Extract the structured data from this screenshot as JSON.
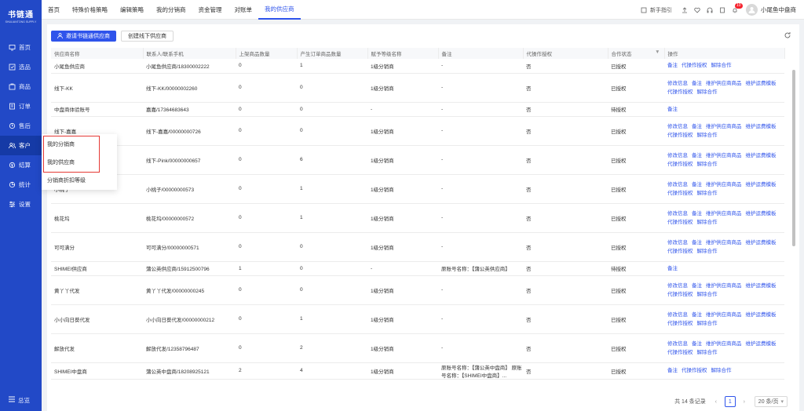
{
  "brand": {
    "name": "书链通",
    "sub": "SHULIANTONG SUPPLY"
  },
  "sidebar": {
    "items": [
      {
        "label": "首页",
        "icon": "monitor-icon"
      },
      {
        "label": "选品",
        "icon": "select-icon"
      },
      {
        "label": "商品",
        "icon": "goods-icon"
      },
      {
        "label": "订单",
        "icon": "order-icon"
      },
      {
        "label": "售后",
        "icon": "aftersale-icon"
      },
      {
        "label": "客户",
        "icon": "customer-icon"
      },
      {
        "label": "结算",
        "icon": "settle-icon"
      },
      {
        "label": "统计",
        "icon": "stats-icon"
      },
      {
        "label": "设置",
        "icon": "settings-icon"
      }
    ],
    "bottom": "总览"
  },
  "topnav": {
    "tabs": [
      "首页",
      "特殊价格策略",
      "编辑策略",
      "我的分销商",
      "资金管理",
      "对账单",
      "我的供应商"
    ],
    "active": 6
  },
  "topright": {
    "guide": "新手指引",
    "badge": "10",
    "user": "小尾鱼中盘商"
  },
  "toolbar": {
    "invite": "邀请书链通供应商",
    "create": "创建线下供应商"
  },
  "table": {
    "headers": [
      "供应商名称",
      "联系人/联系手机",
      "上架商品数量",
      "产生订单商品数量",
      "赋予等级名称",
      "备注",
      "代操作授权",
      "合作状态",
      "操作"
    ],
    "rows": [
      {
        "cells": [
          "小尾鱼供应商",
          "小尾鱼供应商/18300002222",
          "0",
          "1",
          "1级分销商",
          "-",
          "否",
          "已授权"
        ],
        "ops": [
          "备注",
          "代操作授权",
          "解除合作"
        ]
      },
      {
        "cells": [
          "线下-KK",
          "线下-KK/00000002260",
          "0",
          "0",
          "1级分销商",
          "-",
          "否",
          "已授权"
        ],
        "ops": [
          "修改信息",
          "备注",
          "维护供应商商品",
          "维护运费模板",
          "代操作授权",
          "解除合作"
        ]
      },
      {
        "cells": [
          "中盘商体验账号",
          "嘉嘉/17364683643",
          "0",
          "0",
          "-",
          "-",
          "否",
          "待授权"
        ],
        "ops": [
          "备注"
        ]
      },
      {
        "cells": [
          "线下-嘉嘉",
          "线下-嘉嘉/00000000726",
          "0",
          "0",
          "1级分销商",
          "-",
          "否",
          "已授权"
        ],
        "ops": [
          "修改信息",
          "备注",
          "维护供应商商品",
          "维护运费模板",
          "代操作授权",
          "解除合作"
        ]
      },
      {
        "cells": [
          "线下-Pink",
          "线下-Pink/00000000657",
          "0",
          "6",
          "1级分销商",
          "-",
          "否",
          "已授权"
        ],
        "ops": [
          "修改信息",
          "备注",
          "维护供应商商品",
          "维护运费模板",
          "代操作授权",
          "解除合作"
        ]
      },
      {
        "cells": [
          "小桃子",
          "小桃子/00000000573",
          "0",
          "1",
          "1级分销商",
          "-",
          "否",
          "已授权"
        ],
        "ops": [
          "修改信息",
          "备注",
          "维护供应商商品",
          "维护运费模板",
          "代操作授权",
          "解除合作"
        ]
      },
      {
        "cells": [
          "桃花坞",
          "桃花坞/00000000572",
          "0",
          "1",
          "1级分销商",
          "-",
          "否",
          "已授权"
        ],
        "ops": [
          "修改信息",
          "备注",
          "维护供应商商品",
          "维护运费模板",
          "代操作授权",
          "解除合作"
        ]
      },
      {
        "cells": [
          "可可满分",
          "可可满分/00000000571",
          "0",
          "0",
          "1级分销商",
          "-",
          "否",
          "已授权"
        ],
        "ops": [
          "修改信息",
          "备注",
          "维护供应商商品",
          "维护运费模板",
          "代操作授权",
          "解除合作"
        ]
      },
      {
        "cells": [
          "SHIMEI供应商",
          "蒲公英供应商/15912500796",
          "1",
          "0",
          "-",
          "原账号名称：【蒲公英供应商】",
          "否",
          "待授权"
        ],
        "ops": [
          "备注"
        ]
      },
      {
        "cells": [
          "黄丫丫代发",
          "黄丫丫代发/00000000245",
          "0",
          "0",
          "1级分销商",
          "-",
          "否",
          "已授权"
        ],
        "ops": [
          "修改信息",
          "备注",
          "维护供应商商品",
          "维护运费模板",
          "代操作授权",
          "解除合作"
        ]
      },
      {
        "cells": [
          "小小向日葵代发",
          "小小向日葵代发/00000000212",
          "0",
          "1",
          "1级分销商",
          "-",
          "否",
          "已授权"
        ],
        "ops": [
          "修改信息",
          "备注",
          "维护供应商商品",
          "维护运费模板",
          "代操作授权",
          "解除合作"
        ]
      },
      {
        "cells": [
          "解放代发",
          "解放代发/12358796487",
          "0",
          "2",
          "1级分销商",
          "-",
          "否",
          "已授权"
        ],
        "ops": [
          "修改信息",
          "备注",
          "维护供应商商品",
          "维护运费模板",
          "代操作授权",
          "解除合作"
        ]
      },
      {
        "cells": [
          "SHIMEI中盘商",
          "蒲公英中盘商/18208925121",
          "2",
          "4",
          "1级分销商",
          "原账号名称：【蒲公英中盘商】 原账号名称：【SHIMEI中盘商】...",
          "否",
          "已授权"
        ],
        "ops": [
          "备注",
          "代操作授权",
          "解除合作"
        ]
      }
    ]
  },
  "flyout": {
    "items": [
      "我的分销商",
      "我的供应商",
      "分销商折扣等级"
    ]
  },
  "pager": {
    "total": "共 14 条记录",
    "current": "1",
    "size": "20 条/页"
  }
}
